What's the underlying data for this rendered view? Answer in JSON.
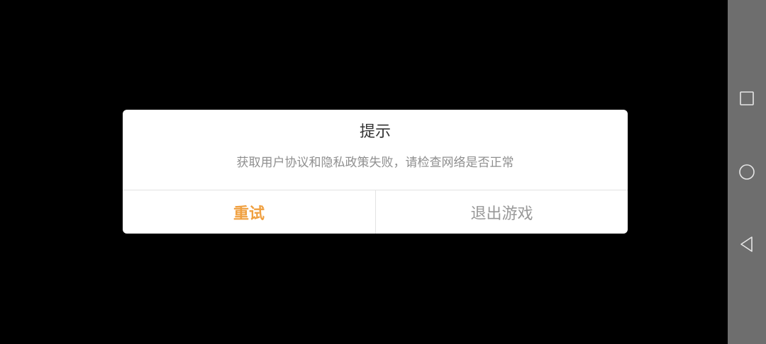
{
  "dialog": {
    "title": "提示",
    "message": "获取用户协议和隐私政策失败，请检查网络是否正常",
    "retry_label": "重试",
    "exit_label": "退出游戏"
  },
  "nav_bar": {
    "recent_icon": "square-recent-apps-icon",
    "home_icon": "circle-home-icon",
    "back_icon": "triangle-back-icon"
  },
  "colors": {
    "background": "#000000",
    "dialog_bg": "#ffffff",
    "title_text": "#333333",
    "message_text": "#8f8f8f",
    "retry_accent": "#f0a040",
    "exit_text": "#999999",
    "divider": "#e3e3e3",
    "nav_bar_bg": "#6e6e6e",
    "nav_icon": "#e6e6e6"
  }
}
